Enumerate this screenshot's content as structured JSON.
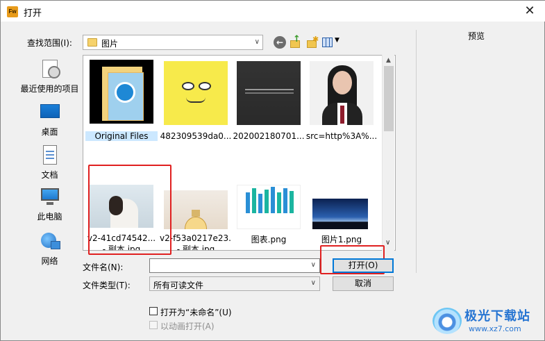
{
  "window": {
    "app_icon_text": "Fw",
    "title": "打开",
    "close_glyph": "✕"
  },
  "look_in": {
    "label": "查找范围(I):",
    "value": "图片"
  },
  "toolbar": {
    "icons": [
      "back-icon",
      "up-folder-icon",
      "new-folder-icon",
      "view-menu-icon"
    ]
  },
  "preview": {
    "label": "预览"
  },
  "places": [
    {
      "label": "最近使用的项目",
      "icon": "recent-items-icon"
    },
    {
      "label": "桌面",
      "icon": "desktop-icon"
    },
    {
      "label": "文档",
      "icon": "documents-icon"
    },
    {
      "label": "此电脑",
      "icon": "this-pc-icon"
    },
    {
      "label": "网络",
      "icon": "network-icon"
    }
  ],
  "files": [
    {
      "name": "Original Files",
      "selected": true
    },
    {
      "name": "482309539da0..."
    },
    {
      "name": "202002180701..."
    },
    {
      "name": "src=http%3A%..."
    },
    {
      "name": "v2-41cd74542...",
      "name2": "- 副本.jpg"
    },
    {
      "name": "v2-f53a0217e23...",
      "name2": "- 副本.jpg"
    },
    {
      "name": "图表.png"
    },
    {
      "name": "图片1.png"
    }
  ],
  "filename": {
    "label": "文件名(N):",
    "value": ""
  },
  "filetype": {
    "label": "文件类型(T):",
    "value": "所有可读文件"
  },
  "buttons": {
    "open": "打开(O)",
    "cancel": "取消"
  },
  "options": {
    "open_as_untitled": "打开为“未命名”(U)",
    "open_as_animation": "以动画打开(A)"
  },
  "watermark": {
    "title": "极光下载站",
    "url": "www.xz7.com"
  },
  "colors": {
    "highlight_box": "#e02020",
    "selection": "#cce8ff",
    "default_button_border": "#0078d7"
  }
}
